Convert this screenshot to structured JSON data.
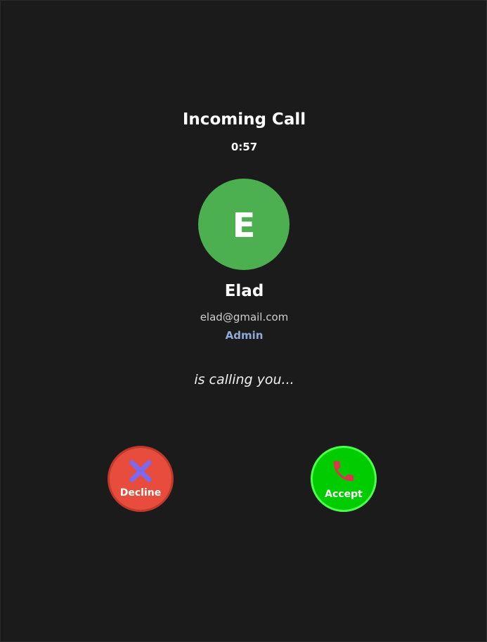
{
  "call": {
    "title": "Incoming Call",
    "timer": "0:57",
    "calling_text": "is calling you..."
  },
  "caller": {
    "initial": "E",
    "name": "Elad",
    "email": "elad@gmail.com",
    "role": "Admin",
    "avatar_color": "#4caf50"
  },
  "actions": {
    "decline": {
      "label": "Decline",
      "icon": "close-icon",
      "color": "#e74c3c",
      "icon_color": "#7b68ee"
    },
    "accept": {
      "label": "Accept",
      "icon": "phone-icon",
      "color": "#00cc00",
      "icon_color": "#e0334d"
    }
  },
  "theme": {
    "background": "#1b1b1b",
    "role_color": "#8fa8d6"
  }
}
